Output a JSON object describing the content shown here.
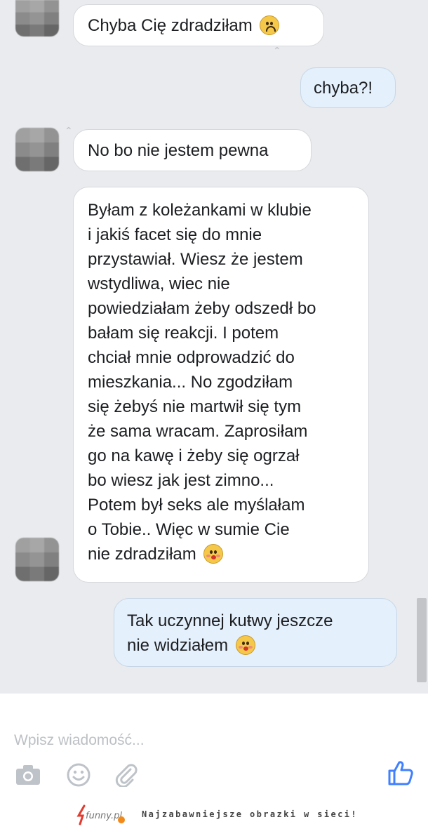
{
  "messages": [
    {
      "text": "Chyba Cię zdradziłam",
      "emoji": "sad-face-icon"
    },
    {
      "text": "chyba?!"
    },
    {
      "text": "No bo nie jestem pewna"
    },
    {
      "lines": [
        "Byłam z koleżankami w klubie",
        "i jakiś facet się do mnie",
        "przystawiał. Wiesz że jestem",
        "wstydliwa, wiec nie",
        "powiedziałam żeby odszedł bo",
        "bałam się reakcji. I potem",
        "chciał mnie odprowadzić do",
        "mieszkania... No zgodziłam",
        "się żebyś nie martwił się tym",
        "że sama wracam. Zaprosiłam",
        "go na kawę i żeby się ogrzał",
        "bo wiesz jak jest zimno...",
        "Potem był seks ale myślałam",
        "o Tobie.. Więc w sumie Cie",
        "nie zdradziłam"
      ],
      "emoji": "kiss-face-icon"
    },
    {
      "lines": [
        "Tak uczynnej kuŧwy jeszcze",
        "nie widziałem"
      ],
      "emoji": "kiss-face-icon"
    }
  ],
  "composer": {
    "placeholder": "Wpisz wiadomość..."
  },
  "toolbar": {
    "icons": [
      "camera-icon",
      "smiley-icon",
      "paperclip-icon",
      "thumbs-up-icon"
    ]
  },
  "footer": {
    "logo_text": "funny.pl",
    "tagline": "Najzabawniejsze obrazki w sieci!"
  },
  "colors": {
    "chat_bg": "#e9ebee",
    "incoming_bubble": "#ffffff",
    "outgoing_bubble": "#e4f0fc",
    "like_blue": "#4080ff"
  }
}
